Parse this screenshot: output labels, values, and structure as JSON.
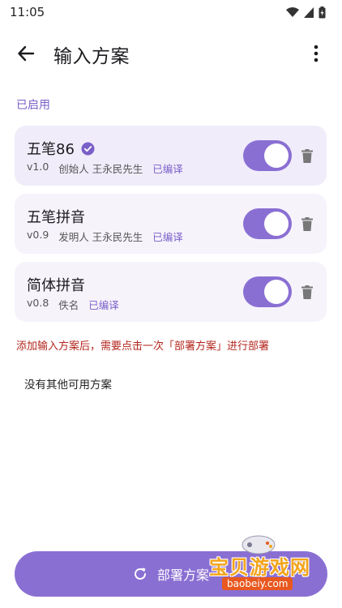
{
  "status_bar": {
    "time": "11:05"
  },
  "app_bar": {
    "title": "输入方案"
  },
  "section": {
    "enabled_label": "已启用"
  },
  "schemes": [
    {
      "name": "五笔86",
      "verified": true,
      "version": "v1.0",
      "author": "创始人 王永民先生",
      "status": "已编译",
      "enabled": true
    },
    {
      "name": "五笔拼音",
      "verified": false,
      "version": "v0.9",
      "author": "发明人 王永民先生",
      "status": "已编译",
      "enabled": true
    },
    {
      "name": "简体拼音",
      "verified": false,
      "version": "v0.8",
      "author": "佚名",
      "status": "已编译",
      "enabled": true
    }
  ],
  "notice": "添加输入方案后，需要点击一次「部署方案」进行部署",
  "empty_text": "没有其他可用方案",
  "deploy_button": {
    "label": "部署方案"
  },
  "watermark": {
    "text": "宝贝游戏网",
    "subtext": "baobeiy.com"
  },
  "colors": {
    "accent": "#8a6fd3",
    "accent_text": "#7a5fc8",
    "warning": "#b3261e",
    "card_bg": "#f6f3fb"
  }
}
